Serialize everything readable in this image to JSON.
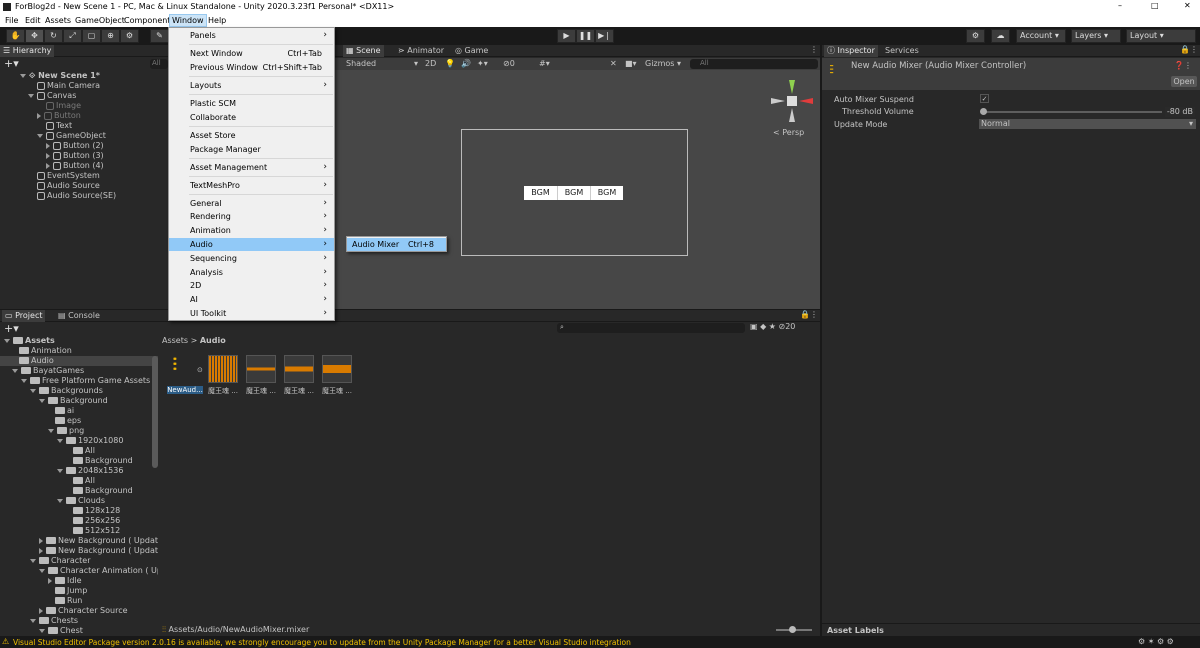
{
  "title_bar": {
    "text": "ForBlog2d - New Scene 1 - PC, Mac & Linux Standalone - Unity 2020.3.23f1 Personal* <DX11>",
    "minimize": "–",
    "maximize": "□",
    "close": "✕"
  },
  "menu": [
    "File",
    "Edit",
    "Assets",
    "GameObject",
    "Component",
    "Window",
    "Help"
  ],
  "toolbar": {
    "account": "Account",
    "layers": "Layers",
    "layout": "Layout"
  },
  "hierarchy": {
    "tab": "Hierarchy",
    "search": "All",
    "items": [
      "New Scene 1*",
      "Main Camera",
      "Canvas",
      "Image",
      "Button",
      "Text",
      "GameObject",
      "Button (2)",
      "Button (3)",
      "Button (4)",
      "EventSystem",
      "Audio Source",
      "Audio Source(SE)"
    ]
  },
  "scene": {
    "tabs": [
      "Scene",
      "Animator",
      "Game"
    ],
    "shading": "Shaded",
    "mode2d": "2D",
    "fx_count": "0",
    "gizmos": "Gizmos",
    "search": "All",
    "persp": "< Persp",
    "buttons": [
      "BGM",
      "BGM",
      "BGM"
    ]
  },
  "window_menu": {
    "items": [
      {
        "label": "Panels",
        "shortcut": "",
        "arrow": true
      },
      {
        "label": "Next Window",
        "shortcut": "Ctrl+Tab",
        "arrow": false
      },
      {
        "label": "Previous Window",
        "shortcut": "Ctrl+Shift+Tab",
        "arrow": false
      },
      {
        "label": "Layouts",
        "shortcut": "",
        "arrow": true
      },
      {
        "label": "Plastic SCM",
        "shortcut": "",
        "arrow": false
      },
      {
        "label": "Collaborate",
        "shortcut": "",
        "arrow": false
      },
      {
        "label": "Asset Store",
        "shortcut": "",
        "arrow": false
      },
      {
        "label": "Package Manager",
        "shortcut": "",
        "arrow": false
      },
      {
        "label": "Asset Management",
        "shortcut": "",
        "arrow": true
      },
      {
        "label": "TextMeshPro",
        "shortcut": "",
        "arrow": true
      },
      {
        "label": "General",
        "shortcut": "",
        "arrow": true
      },
      {
        "label": "Rendering",
        "shortcut": "",
        "arrow": true
      },
      {
        "label": "Animation",
        "shortcut": "",
        "arrow": true
      },
      {
        "label": "Audio",
        "shortcut": "",
        "arrow": true
      },
      {
        "label": "Sequencing",
        "shortcut": "",
        "arrow": true
      },
      {
        "label": "Analysis",
        "shortcut": "",
        "arrow": true
      },
      {
        "label": "2D",
        "shortcut": "",
        "arrow": true
      },
      {
        "label": "AI",
        "shortcut": "",
        "arrow": true
      },
      {
        "label": "UI Toolkit",
        "shortcut": "",
        "arrow": true
      }
    ],
    "submenu": {
      "label": "Audio Mixer",
      "shortcut": "Ctrl+8"
    }
  },
  "inspector": {
    "tabs": [
      "Inspector",
      "Services"
    ],
    "title": "New Audio Mixer (Audio Mixer Controller)",
    "open": "Open",
    "fields": {
      "auto_suspend": "Auto Mixer Suspend",
      "threshold": "Threshold Volume",
      "threshold_value": "-80 dB",
      "update_mode": "Update Mode",
      "update_mode_value": "Normal"
    },
    "asset_labels": "Asset Labels"
  },
  "project": {
    "tabs": [
      "Project",
      "Console"
    ],
    "breadcrumb": [
      "Assets",
      "Audio"
    ],
    "count": "20",
    "footer_path": "Assets/Audio/NewAudioMixer.mixer",
    "tree": [
      "Assets",
      "Animation",
      "Audio",
      "BayatGames",
      "Free Platform Game Assets",
      "Backgrounds",
      "Background",
      "ai",
      "eps",
      "png",
      "1920x1080",
      "All",
      "Background",
      "2048x1536",
      "All",
      "Background",
      "Clouds",
      "128x128",
      "256x256",
      "512x512",
      "New Background ( Update",
      "New Background ( Update",
      "Character",
      "Character Animation ( Upda",
      "Idle",
      "Jump",
      "Run",
      "Character Source",
      "Chests",
      "Chest"
    ],
    "assets": [
      "NewAud...",
      "魔王魂 ...",
      "魔王魂 ...",
      "魔王魂 ...",
      "魔王魂 ..."
    ]
  },
  "status_bar": {
    "text": "Visual Studio Editor Package version 2.0.16 is available, we strongly encourage you to update from the Unity Package Manager for a better Visual Studio integration"
  },
  "colors": {
    "menu_highlight": "#91c9f7",
    "selection": "#2c5d87",
    "warning": "#f0c000"
  }
}
